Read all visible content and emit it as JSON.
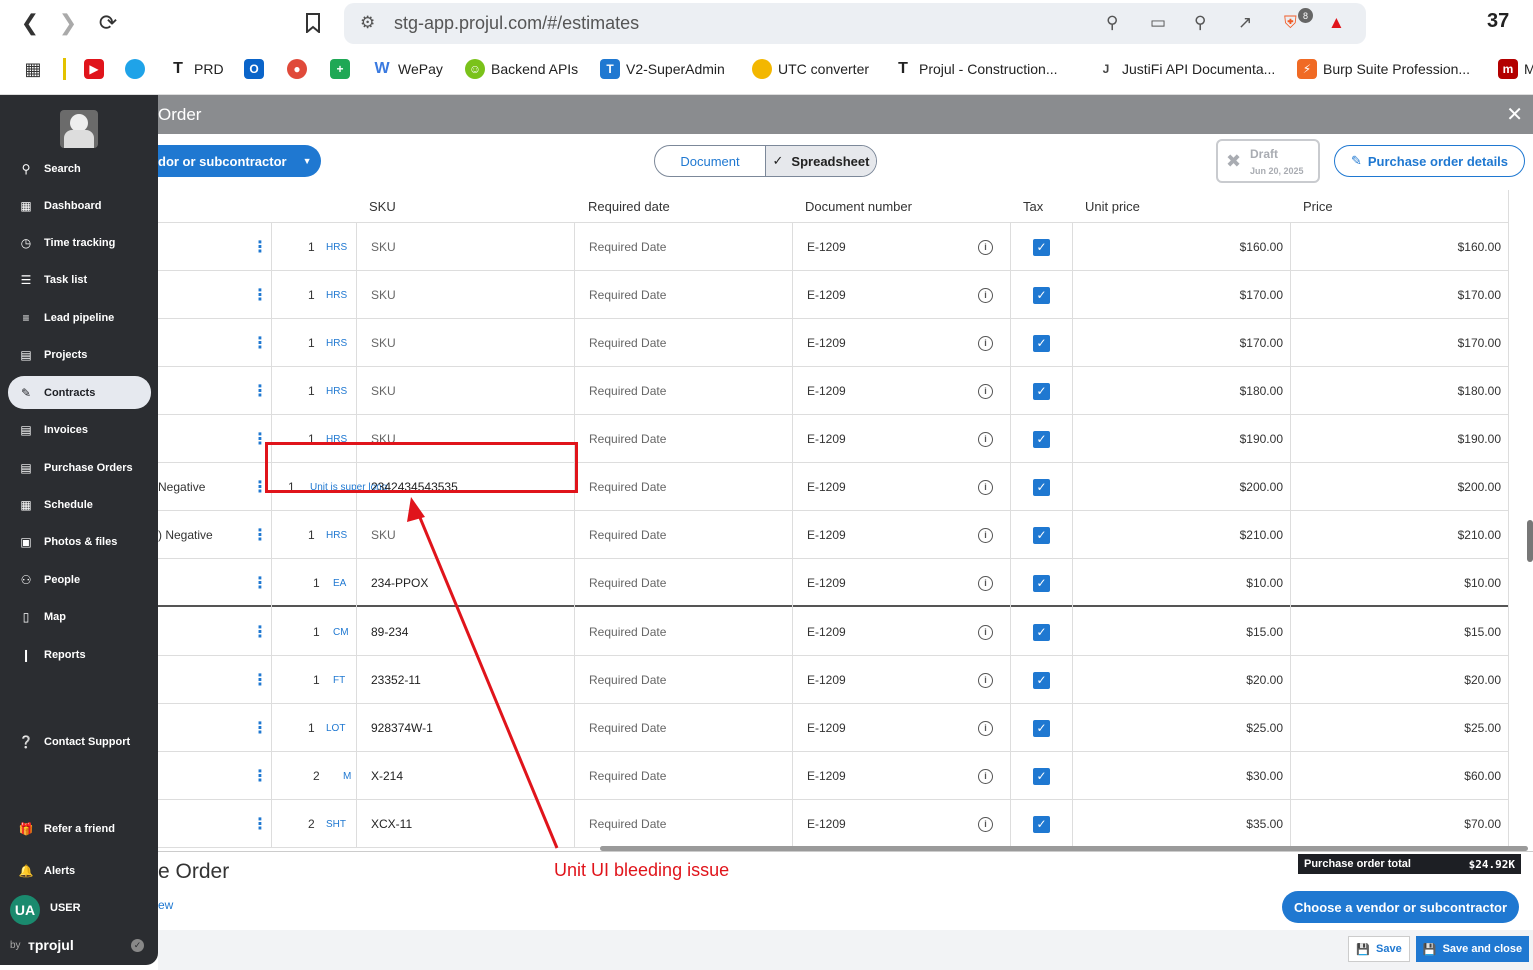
{
  "browser": {
    "url": "stg-app.projul.com/#/estimates",
    "tab_count": "37",
    "shield_badge": "8",
    "bookmarks": [
      {
        "label": "",
        "icon": "apps-icon"
      },
      {
        "label": "",
        "icon": "youtube-icon"
      },
      {
        "label": "",
        "icon": "edge-icon"
      },
      {
        "label": "PRD",
        "icon": "projul-icon"
      },
      {
        "label": "",
        "icon": "outlook-icon"
      },
      {
        "label": "",
        "icon": "record-icon"
      },
      {
        "label": "",
        "icon": "plus-icon"
      },
      {
        "label": "WePay",
        "icon": "wepay-icon"
      },
      {
        "label": "Backend APIs",
        "icon": "smile-icon"
      },
      {
        "label": "V2-SuperAdmin",
        "icon": "t-icon"
      },
      {
        "label": "UTC converter",
        "icon": "clock-icon"
      },
      {
        "label": "Projul - Construction...",
        "icon": "projul-icon"
      },
      {
        "label": "JustiFi API Documenta...",
        "icon": "justifi-icon"
      },
      {
        "label": "Burp Suite Profession...",
        "icon": "burp-icon"
      },
      {
        "label": "M",
        "icon": "m-icon"
      }
    ]
  },
  "sidebar": {
    "items": [
      {
        "label": "Search",
        "icon": "search-icon"
      },
      {
        "label": "Dashboard",
        "icon": "dashboard-icon"
      },
      {
        "label": "Time tracking",
        "icon": "clock-icon"
      },
      {
        "label": "Task list",
        "icon": "checklist-icon"
      },
      {
        "label": "Lead pipeline",
        "icon": "pipeline-icon"
      },
      {
        "label": "Projects",
        "icon": "projects-icon"
      },
      {
        "label": "Contracts",
        "icon": "contracts-icon"
      },
      {
        "label": "Invoices",
        "icon": "invoice-icon"
      },
      {
        "label": "Purchase Orders",
        "icon": "purchase-order-icon"
      },
      {
        "label": "Schedule",
        "icon": "calendar-icon"
      },
      {
        "label": "Photos & files",
        "icon": "photos-icon"
      },
      {
        "label": "People",
        "icon": "people-icon"
      },
      {
        "label": "Map",
        "icon": "map-icon"
      },
      {
        "label": "Reports",
        "icon": "reports-icon"
      }
    ],
    "contact_support": "Contact Support",
    "refer": "Refer a friend",
    "alerts": "Alerts",
    "user_initials": "UA",
    "user_name": "USER",
    "by": "by",
    "brand": "projul"
  },
  "modal": {
    "title": "Order",
    "vendor_button": "dor or subcontractor",
    "view_document": "Document",
    "view_spreadsheet": "Spreadsheet",
    "draft_label": "Draft",
    "draft_date": "Jun 20, 2025",
    "details_button": "Purchase order details"
  },
  "table": {
    "headers": {
      "sku": "SKU",
      "required_date": "Required date",
      "document_number": "Document number",
      "tax": "Tax",
      "unit_price": "Unit price",
      "price": "Price"
    },
    "rows": [
      {
        "name": "",
        "qty": "1",
        "unit": "HRS",
        "sku": "SKU",
        "date": "Required Date",
        "doc": "E-1209",
        "unit_price": "$160.00",
        "price": "$160.00"
      },
      {
        "name": "",
        "qty": "1",
        "unit": "HRS",
        "sku": "SKU",
        "date": "Required Date",
        "doc": "E-1209",
        "unit_price": "$170.00",
        "price": "$170.00"
      },
      {
        "name": "",
        "qty": "1",
        "unit": "HRS",
        "sku": "SKU",
        "date": "Required Date",
        "doc": "E-1209",
        "unit_price": "$170.00",
        "price": "$170.00"
      },
      {
        "name": "",
        "qty": "1",
        "unit": "HRS",
        "sku": "SKU",
        "date": "Required Date",
        "doc": "E-1209",
        "unit_price": "$180.00",
        "price": "$180.00"
      },
      {
        "name": "",
        "qty": "1",
        "unit": "HRS",
        "sku": "SKU",
        "date": "Required Date",
        "doc": "E-1209",
        "unit_price": "$190.00",
        "price": "$190.00"
      },
      {
        "name": "Negative",
        "qty": "1",
        "unit": "Unit is super long",
        "sku": "2342434543535",
        "date": "Required Date",
        "doc": "E-1209",
        "unit_price": "$200.00",
        "price": "$200.00"
      },
      {
        "name": ") Negative",
        "qty": "1",
        "unit": "HRS",
        "sku": "SKU",
        "date": "Required Date",
        "doc": "E-1209",
        "unit_price": "$210.00",
        "price": "$210.00"
      },
      {
        "name": "",
        "qty": "1",
        "unit": "EA",
        "sku": "234-PPOX",
        "date": "Required Date",
        "doc": "E-1209",
        "unit_price": "$10.00",
        "price": "$10.00"
      },
      {
        "name": "",
        "qty": "1",
        "unit": "CM",
        "sku": "89-234",
        "date": "Required Date",
        "doc": "E-1209",
        "unit_price": "$15.00",
        "price": "$15.00"
      },
      {
        "name": "",
        "qty": "1",
        "unit": "FT",
        "sku": "23352-11",
        "date": "Required Date",
        "doc": "E-1209",
        "unit_price": "$20.00",
        "price": "$20.00"
      },
      {
        "name": "",
        "qty": "1",
        "unit": "LOT",
        "sku": "928374W-1",
        "date": "Required Date",
        "doc": "E-1209",
        "unit_price": "$25.00",
        "price": "$25.00"
      },
      {
        "name": "",
        "qty": "2",
        "unit": "M",
        "sku": "X-214",
        "date": "Required Date",
        "doc": "E-1209",
        "unit_price": "$30.00",
        "price": "$60.00"
      },
      {
        "name": "",
        "qty": "2",
        "unit": "SHT",
        "sku": "XCX-11",
        "date": "Required Date",
        "doc": "E-1209",
        "unit_price": "$35.00",
        "price": "$70.00"
      }
    ]
  },
  "footer": {
    "title": "e Order",
    "link": "ew",
    "total_label": "Purchase order total",
    "total_value": "$24.92K",
    "choose_vendor": "Choose a vendor or subcontractor",
    "save": "Save",
    "save_close": "Save and close"
  },
  "annotation": {
    "text": "Unit UI bleeding issue",
    "color": "#e0141b"
  },
  "colors": {
    "accent": "#1f78d1",
    "sidebar": "#2b2d31"
  }
}
